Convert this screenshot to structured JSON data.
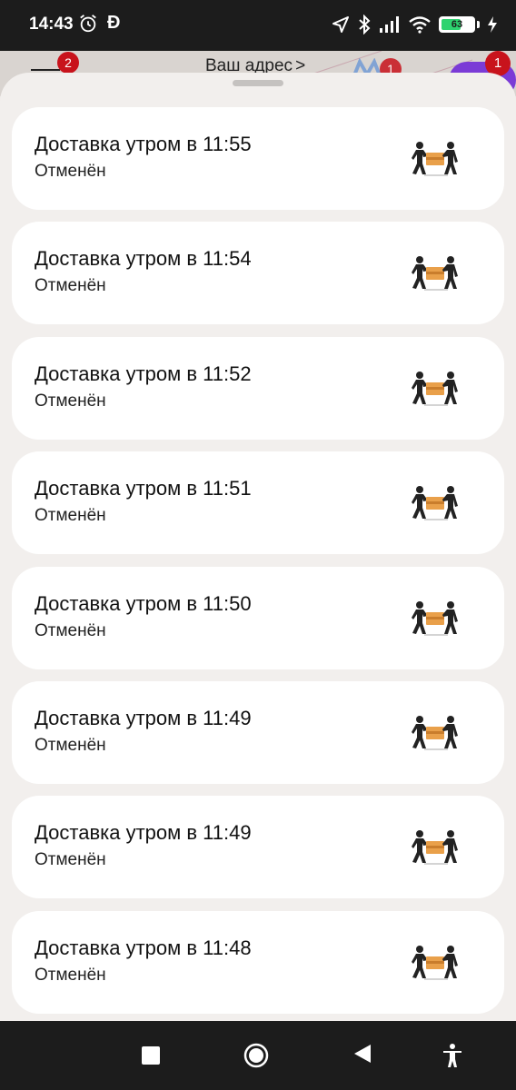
{
  "status_bar": {
    "time": "14:43",
    "app_letter": "Ð",
    "battery_level": "63",
    "battery_fraction": 0.63
  },
  "header": {
    "menu_badge": "2",
    "address_label": "Ваш адрес",
    "address_chevron": ">",
    "metro_badge": "1",
    "promo_badge": "1"
  },
  "orders": [
    {
      "title": "Доставка утром в 11:55",
      "status": "Отменён",
      "icon": "courier-delivery-icon"
    },
    {
      "title": "Доставка утром в 11:54",
      "status": "Отменён",
      "icon": "courier-delivery-icon"
    },
    {
      "title": "Доставка утром в 11:52",
      "status": "Отменён",
      "icon": "courier-delivery-icon"
    },
    {
      "title": "Доставка утром в 11:51",
      "status": "Отменён",
      "icon": "courier-delivery-icon"
    },
    {
      "title": "Доставка утром в 11:50",
      "status": "Отменён",
      "icon": "courier-delivery-icon"
    },
    {
      "title": "Доставка утром в 11:49",
      "status": "Отменён",
      "icon": "courier-delivery-icon"
    },
    {
      "title": "Доставка утром в 11:49",
      "status": "Отменён",
      "icon": "courier-delivery-icon"
    },
    {
      "title": "Доставка утром в 11:48",
      "status": "Отменён",
      "icon": "courier-delivery-icon"
    }
  ],
  "colors": {
    "badge_red": "#c8131c",
    "battery_green": "#2dd36f",
    "box_orange": "#e9a04a"
  }
}
